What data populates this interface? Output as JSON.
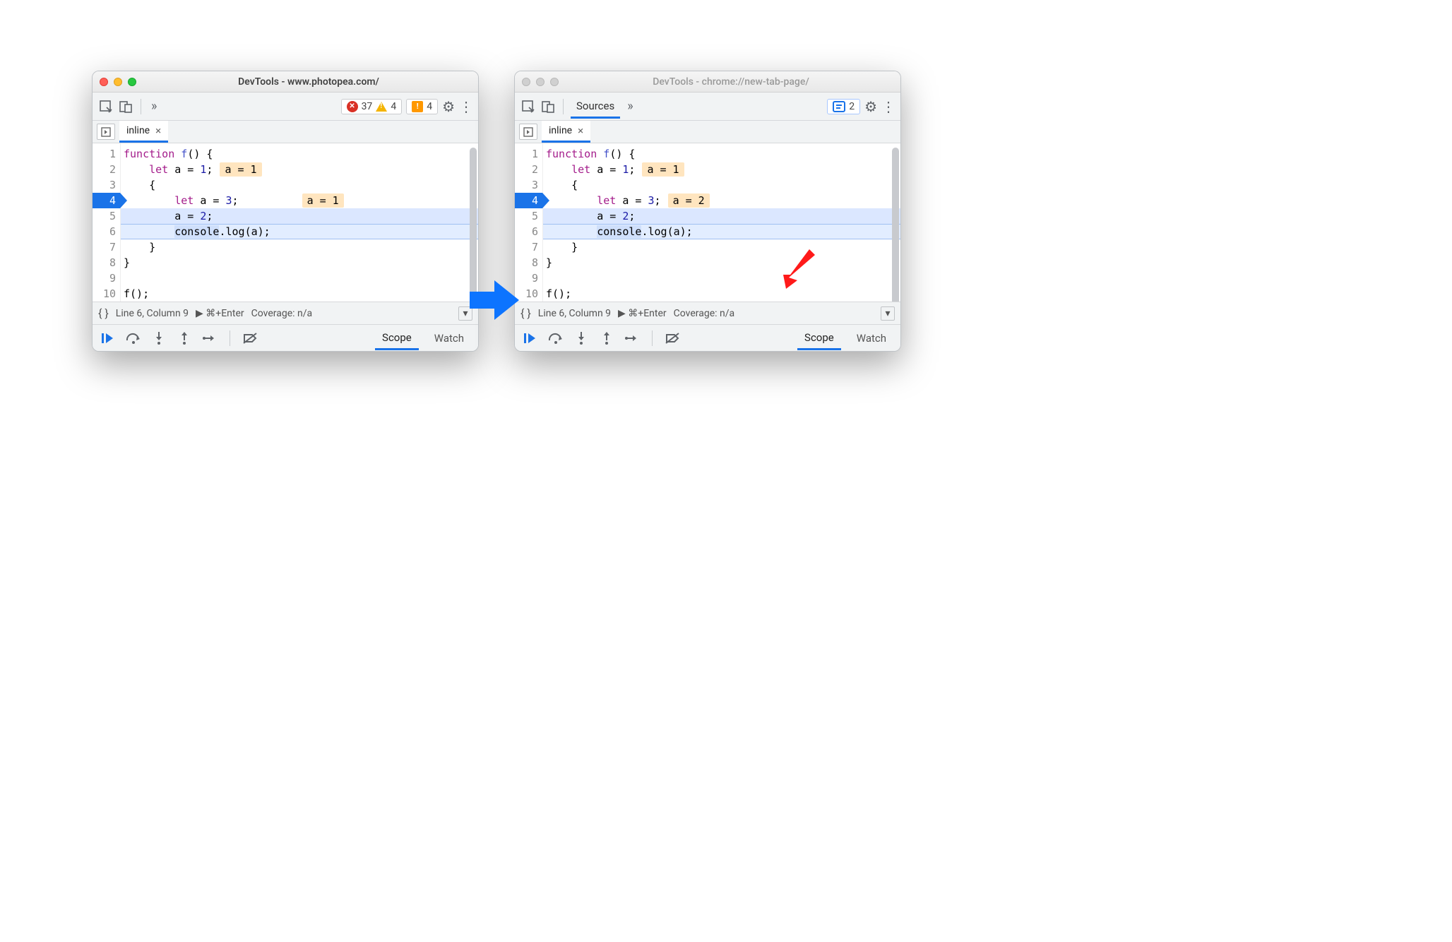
{
  "left": {
    "title": "DevTools - www.photopea.com/",
    "counts": {
      "errors": "37",
      "warnings": "4",
      "issues": "4"
    },
    "filetab": "inline",
    "code": {
      "lines": [
        "1",
        "2",
        "3",
        "4",
        "5",
        "6",
        "7",
        "8",
        "9",
        "10"
      ],
      "l1_kw": "function",
      "l1_id": " f",
      "l1_rest": "() {",
      "l2_kw": "    let",
      "l2_rest": " a = ",
      "l2_num": "1",
      "l2_semi": ";",
      "l2_badge": "a = 1",
      "l3": "    {",
      "l4_kw": "        let",
      "l4_rest": " a = ",
      "l4_num": "3",
      "l4_semi": ";",
      "l4_badge": "a = 1",
      "l5_pre": "        a = ",
      "l5_num": "2",
      "l5_semi": ";",
      "l6_pre": "        ",
      "l6_sel": "console",
      "l6_rest": ".log(a);",
      "l7": "    }",
      "l8": "}",
      "l9": "",
      "l10": "f();"
    },
    "status_line": "Line 6, Column 9",
    "status_run": "▶ ⌘+Enter",
    "status_cov": "Coverage: n/a",
    "scope": "Scope",
    "watch": "Watch"
  },
  "right": {
    "title": "DevTools - chrome://new-tab-page/",
    "sources_label": "Sources",
    "msg_count": "2",
    "filetab": "inline",
    "code": {
      "lines": [
        "1",
        "2",
        "3",
        "4",
        "5",
        "6",
        "7",
        "8",
        "9",
        "10"
      ],
      "l1_kw": "function",
      "l1_id": " f",
      "l1_rest": "() {",
      "l2_kw": "    let",
      "l2_rest": " a = ",
      "l2_num": "1",
      "l2_semi": ";",
      "l2_badge": "a = 1",
      "l3": "    {",
      "l4_kw": "        let",
      "l4_rest": " a = ",
      "l4_num": "3",
      "l4_semi": ";",
      "l4_badge": "a = 2",
      "l5_pre": "        a = ",
      "l5_num": "2",
      "l5_semi": ";",
      "l6_pre": "        ",
      "l6_sel": "console",
      "l6_rest": ".log(a);",
      "l7": "    }",
      "l8": "}",
      "l9": "",
      "l10": "f();"
    },
    "status_line": "Line 6, Column 9",
    "status_run": "▶ ⌘+Enter",
    "status_cov": "Coverage: n/a",
    "scope": "Scope",
    "watch": "Watch"
  }
}
